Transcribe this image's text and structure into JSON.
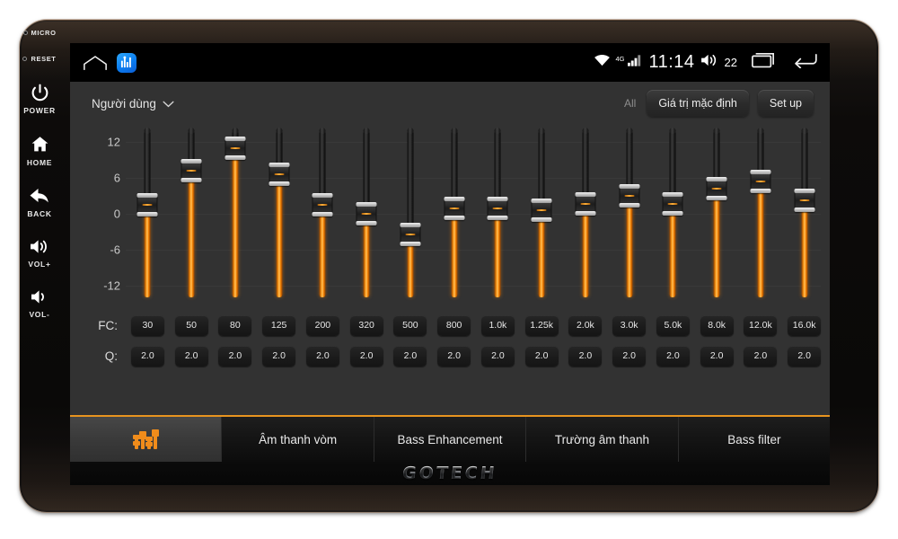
{
  "device": {
    "brand": "GOTECH",
    "bezel_buttons": [
      {
        "id": "micro",
        "label": "MICRO",
        "type": "led"
      },
      {
        "id": "reset",
        "label": "RESET",
        "type": "led"
      },
      {
        "id": "power",
        "label": "POWER",
        "icon": "power-icon"
      },
      {
        "id": "home",
        "label": "HOME",
        "icon": "home-icon"
      },
      {
        "id": "back",
        "label": "BACK",
        "icon": "back-arrow-icon"
      },
      {
        "id": "volup",
        "label": "VOL+",
        "icon": "volume-up-icon"
      },
      {
        "id": "voldown",
        "label": "VOL-",
        "icon": "volume-down-icon"
      }
    ]
  },
  "statusbar": {
    "home_icon": "home-outline-icon",
    "app_icon": "equalizer-app-icon",
    "wifi_icon": "wifi-icon",
    "network_label": "4G",
    "signal_icon": "signal-bars-icon",
    "clock": "11:14",
    "volume_icon": "volume-icon",
    "volume_level": "22",
    "recents_icon": "recents-icon",
    "back_icon": "back-icon"
  },
  "header": {
    "preset_name": "Người dùng",
    "preset_caret": "chevron-down-icon",
    "all_label": "All",
    "default_button": "Giá trị mặc định",
    "setup_button": "Set up"
  },
  "equalizer": {
    "axis_ticks": [
      "12",
      "6",
      "0",
      "-6",
      "-12"
    ],
    "axis_min": -14,
    "axis_max": 14,
    "fc_label": "FC:",
    "q_label": "Q:",
    "bands": [
      {
        "fc": "30",
        "q": "2.0",
        "gain": 1.5
      },
      {
        "fc": "50",
        "q": "2.0",
        "gain": 7.2
      },
      {
        "fc": "80",
        "q": "2.0",
        "gain": 11.0
      },
      {
        "fc": "125",
        "q": "2.0",
        "gain": 6.6
      },
      {
        "fc": "200",
        "q": "2.0",
        "gain": 1.5
      },
      {
        "fc": "320",
        "q": "2.0",
        "gain": 0.0
      },
      {
        "fc": "500",
        "q": "2.0",
        "gain": -3.5
      },
      {
        "fc": "800",
        "q": "2.0",
        "gain": 0.9
      },
      {
        "fc": "1.0k",
        "q": "2.0",
        "gain": 0.9
      },
      {
        "fc": "1.25k",
        "q": "2.0",
        "gain": 0.6
      },
      {
        "fc": "2.0k",
        "q": "2.0",
        "gain": 1.6
      },
      {
        "fc": "3.0k",
        "q": "2.0",
        "gain": 3.0
      },
      {
        "fc": "5.0k",
        "q": "2.0",
        "gain": 1.6
      },
      {
        "fc": "8.0k",
        "q": "2.0",
        "gain": 4.2
      },
      {
        "fc": "12.0k",
        "q": "2.0",
        "gain": 5.4
      },
      {
        "fc": "16.0k",
        "q": "2.0",
        "gain": 2.2
      }
    ]
  },
  "tabs": [
    {
      "id": "equalizer",
      "label": "",
      "icon": "equalizer-icon",
      "active": true
    },
    {
      "id": "surround",
      "label": "Âm thanh vòm",
      "icon": "",
      "active": false
    },
    {
      "id": "bass-enhancement",
      "label": "Bass Enhancement",
      "icon": "",
      "active": false
    },
    {
      "id": "sound-field",
      "label": "Trường âm thanh",
      "icon": "",
      "active": false
    },
    {
      "id": "bass-filter",
      "label": "Bass filter",
      "icon": "",
      "active": false
    }
  ],
  "colors": {
    "accent": "#f08c1b",
    "panel_bg": "#323232",
    "screen_bg": "#000000",
    "app_icon_blue": "#0a7cf0"
  }
}
